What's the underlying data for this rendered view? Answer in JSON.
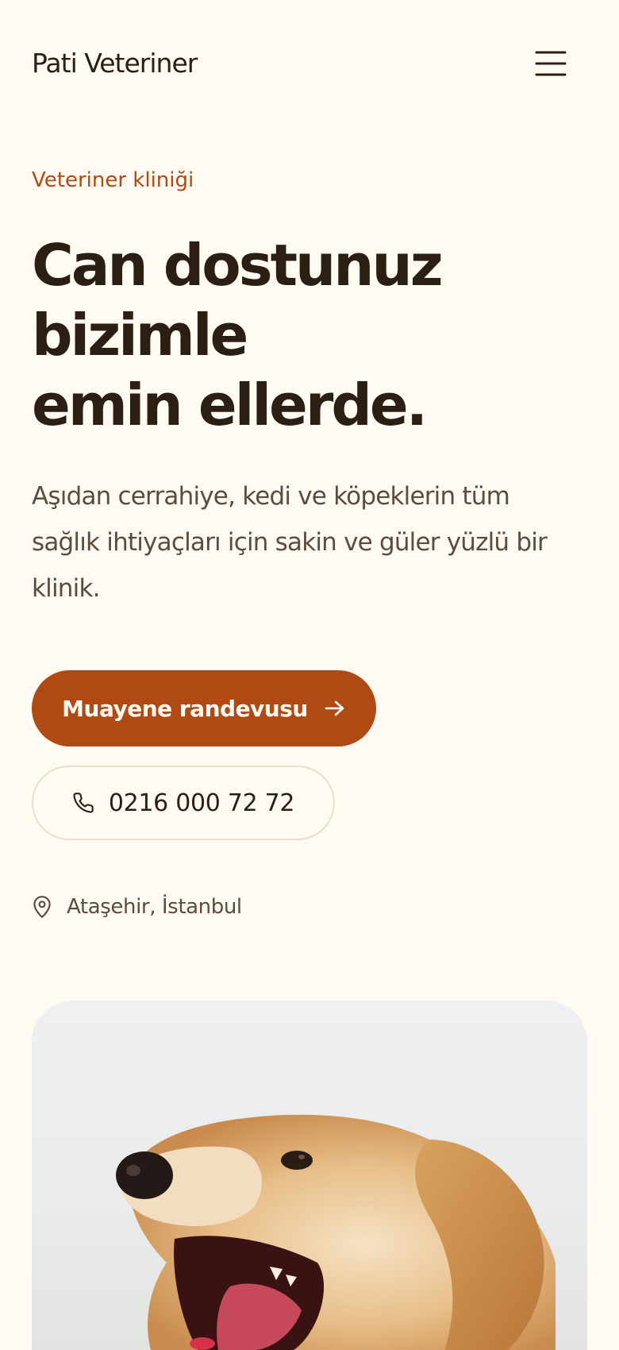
{
  "header": {
    "brand": "Pati Veteriner",
    "menu_icon": "hamburger-menu-icon"
  },
  "hero": {
    "eyebrow": "Veteriner kliniği",
    "headline": [
      "Can dostunuz",
      "bizimle",
      "emin ellerde."
    ],
    "lead": "Aşıdan cerrahiye, kedi ve köpeklerin tüm sağlık ihtiyaçları için sakin ve güler yüzlü bir klinik.",
    "primary_cta": {
      "label": "Muayene randevusu",
      "icon": "arrow-right-icon"
    },
    "secondary_cta": {
      "label": "0216 000 72 72",
      "icon": "phone-icon"
    },
    "location": {
      "label": "Ataşehir, İstanbul",
      "icon": "map-pin-icon"
    },
    "image": {
      "subject": "dog-photo"
    }
  },
  "colors": {
    "background": "#FFFBF3",
    "text": "#2B1E12",
    "muted_text": "#5A4C3F",
    "accent": "#B04A14",
    "outline": "#E8DFC9"
  }
}
